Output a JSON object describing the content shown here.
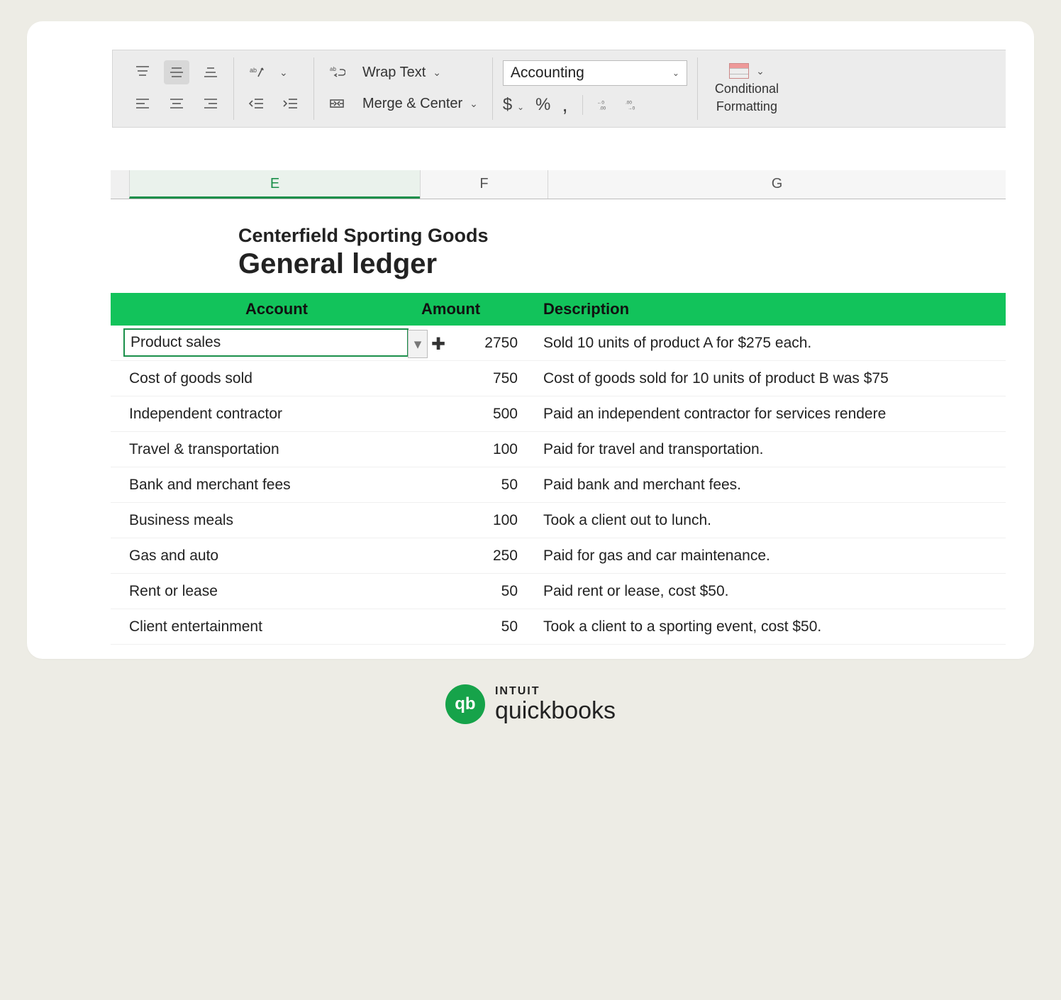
{
  "ribbon": {
    "wrap_text": "Wrap Text",
    "merge_center": "Merge & Center",
    "number_format": "Accounting",
    "conditional_line1": "Conditional",
    "conditional_line2": "Formatting"
  },
  "columns": {
    "e": "E",
    "f": "F",
    "g": "G"
  },
  "sheet": {
    "company": "Centerfield Sporting Goods",
    "title": "General ledger",
    "headers": {
      "account": "Account",
      "amount": "Amount",
      "description": "Description"
    },
    "rows": [
      {
        "account": "Product sales",
        "amount": "2750",
        "description": "Sold 10 units of product A for $275 each."
      },
      {
        "account": "Cost of goods sold",
        "amount": "750",
        "description": "Cost of goods sold for 10 units of product B was $75"
      },
      {
        "account": "Independent contractor",
        "amount": "500",
        "description": "Paid an independent contractor for services rendere"
      },
      {
        "account": "Travel & transportation",
        "amount": "100",
        "description": "Paid for travel and transportation."
      },
      {
        "account": "Bank and merchant fees",
        "amount": "50",
        "description": "Paid bank and merchant fees."
      },
      {
        "account": "Business meals",
        "amount": "100",
        "description": "Took a client out to lunch."
      },
      {
        "account": "Gas and auto",
        "amount": "250",
        "description": "Paid for gas and car maintenance."
      },
      {
        "account": "Rent or lease",
        "amount": "50",
        "description": "Paid rent or lease, cost $50."
      },
      {
        "account": "Client entertainment",
        "amount": "50",
        "description": "Took a client to a sporting event, cost $50."
      }
    ]
  },
  "brand": {
    "mark": "qb",
    "line1": "INTUIT",
    "line2": "quickbooks"
  },
  "icons": {
    "dollar": "$",
    "percent": "%",
    "comma": ",",
    "dec_inc": "←0₀₀",
    "dec_dec": ".00→0"
  }
}
